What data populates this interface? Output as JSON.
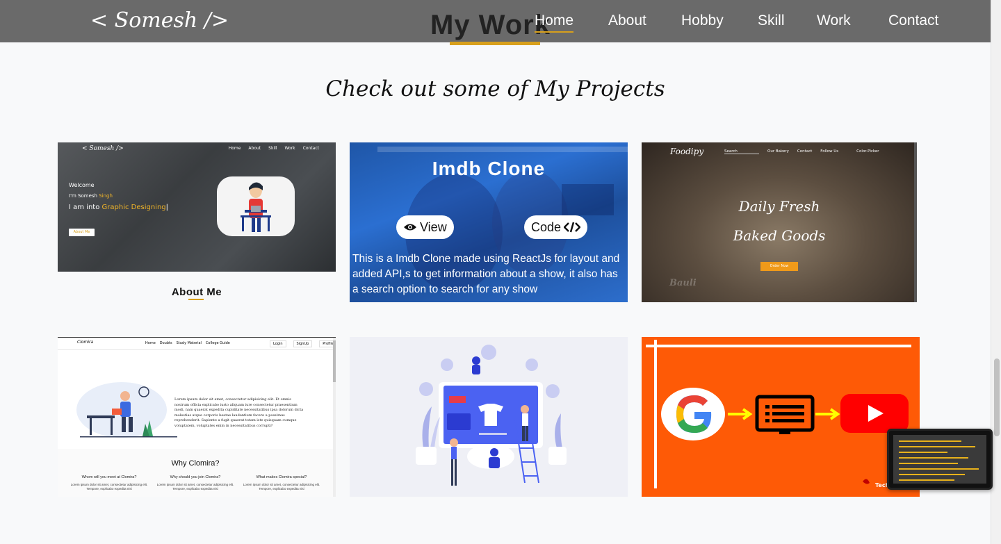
{
  "nav": {
    "brand": "< Somesh />",
    "section_title": "My Work",
    "links": [
      {
        "label": "Home",
        "active": true
      },
      {
        "label": "About",
        "active": false
      },
      {
        "label": "Hobby",
        "active": false
      },
      {
        "label": "Skill",
        "active": false
      },
      {
        "label": "Work",
        "active": false
      },
      {
        "label": "Contact",
        "active": false
      }
    ]
  },
  "subtitle": "Check out some of My Projects",
  "projects": {
    "about": {
      "label": "About Me",
      "mini_brand": "< Somesh />",
      "mini_nav": [
        "Home",
        "About",
        "Skill",
        "Work",
        "Contact"
      ],
      "welcome": "Welcome",
      "im_prefix": "I'm Somesh ",
      "im_name": "Singh",
      "into_prefix": "I am into ",
      "into_value": "Graphic Designing",
      "button": "About Me"
    },
    "imdb": {
      "title": "Imdb Clone",
      "view_label": "View",
      "code_label": "Code",
      "description": "This is a Imdb Clone made using ReactJs for layout and added API,s to get information about a show, it also has a search option to search for any show"
    },
    "foodipy": {
      "brand": "Foodipy",
      "nav": [
        "Search",
        "Our Bakery",
        "Contact",
        "Follow Us",
        "Color-Picker"
      ],
      "hero_line1": "Daily Fresh",
      "hero_line2": "Baked Goods",
      "button": "Order Now",
      "watermark": "Bauli"
    },
    "clomira": {
      "logo": "Clomira",
      "nav": [
        "Home",
        "Doubts",
        "Study Material",
        "College Guide"
      ],
      "right_nav": [
        "Login",
        "SignUp",
        "Profile"
      ],
      "lorem": "Lorem ipsum dolor sit amet, consectetur adipisicing elit. Et omnis nostrum officia explicabo iusto aliquam iure consectetur praesentium modi, nam quaerat expedita cupiditate necessitatibus ipsa dolorum dicta molestias atque corporis beatae laudantium facere a possimus reprehenderit. Sapiente a fugit quaerat totam iste quisquam cumque voluptatem, voluptates enim in necessitatibus corrupti?",
      "why": "Why Clomira?",
      "columns": [
        {
          "q": "Whom will you meet at Clomira?",
          "p": "Lorem ipsum dolor sit amet, consectetur adipisicing elit. Tempore, explicabo expedita nisi"
        },
        {
          "q": "Why should you join Clomira?",
          "p": "Lorem ipsum dolor sit amet, consectetur adipisicing elit. Tempore, explicabo expedita nisi"
        },
        {
          "q": "What makes Clomira special?",
          "p": "Lorem ipsum dolor sit amet, consectetur adipisicing elit. Tempore, explicabo expedita nisi"
        }
      ]
    },
    "yt": {
      "watermark": "Tech"
    }
  },
  "colors": {
    "accent": "#d8a01c",
    "nav_bg": "#646464",
    "orange": "#fe5a06"
  }
}
